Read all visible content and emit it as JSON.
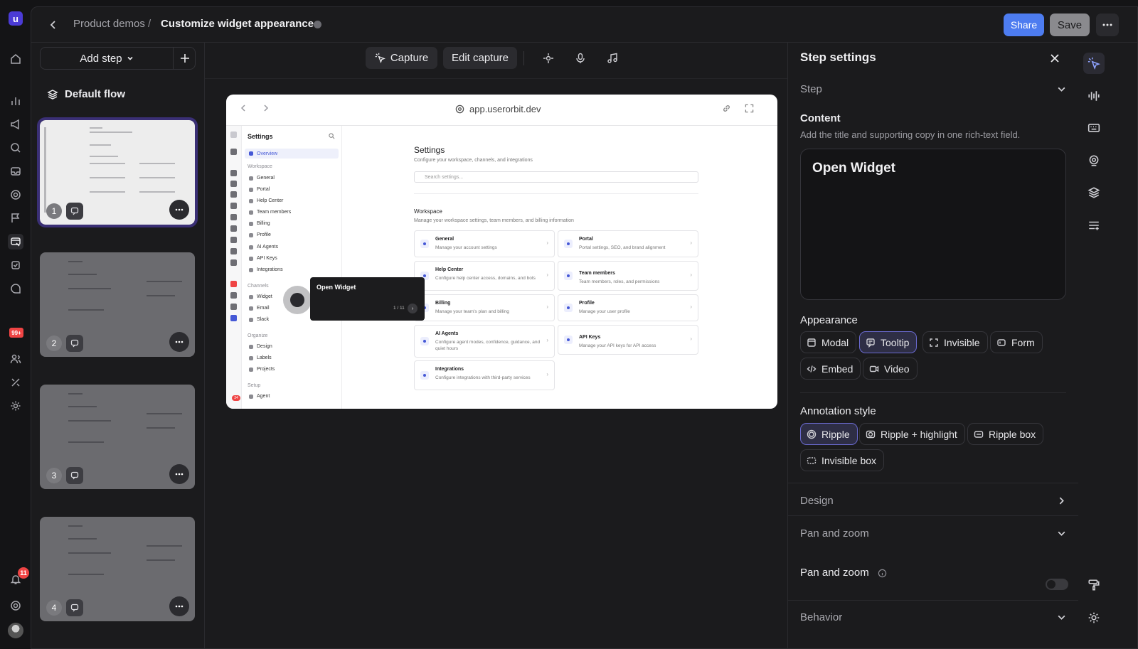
{
  "app": {
    "logo_letter": "u",
    "notification_count": "11",
    "inbox_badge": "99+"
  },
  "header": {
    "breadcrumb_parent": "Product demos",
    "breadcrumb_separator": "/",
    "breadcrumb_current": "Customize widget appearance",
    "share_label": "Share",
    "save_label": "Save"
  },
  "steps_panel": {
    "add_step_label": "Add step",
    "flow_title": "Default flow",
    "steps": [
      {
        "number": "1",
        "selected": true
      },
      {
        "number": "2",
        "selected": false
      },
      {
        "number": "3",
        "selected": false
      },
      {
        "number": "4",
        "selected": false
      }
    ]
  },
  "toolbar": {
    "capture_label": "Capture",
    "edit_capture_label": "Edit capture"
  },
  "preview": {
    "url": "app.userorbit.dev",
    "sidebar_title": "Settings",
    "sidebar_overview": "Overview",
    "sections": {
      "workspace": "Workspace",
      "channels": "Channels",
      "organize": "Organize",
      "setup": "Setup"
    },
    "workspace_items": [
      "General",
      "Portal",
      "Help Center",
      "Team members",
      "Billing",
      "Profile",
      "AI Agents",
      "API Keys",
      "Integrations"
    ],
    "channel_items": [
      "Widget",
      "Email",
      "Slack"
    ],
    "organize_items": [
      "Design",
      "Labels",
      "Projects"
    ],
    "setup_items": [
      "Agent"
    ],
    "main_title": "Settings",
    "main_subtitle": "Configure your workspace, channels, and integrations",
    "search_placeholder": "Search settings...",
    "workspace_title": "Workspace",
    "workspace_subtitle": "Manage your workspace settings, team members, and billing information",
    "cards": [
      {
        "title": "General",
        "desc": "Manage your account settings"
      },
      {
        "title": "Portal",
        "desc": "Portal settings, SEO, and brand alignment"
      },
      {
        "title": "Help Center",
        "desc": "Configure help center access, domains, and bots"
      },
      {
        "title": "Team members",
        "desc": "Team members, roles, and permissions"
      },
      {
        "title": "Billing",
        "desc": "Manage your team's plan and billing"
      },
      {
        "title": "Profile",
        "desc": "Manage your user profile"
      },
      {
        "title": "AI Agents",
        "desc": "Configure agent modes, confidence, guidance, and quiet hours"
      },
      {
        "title": "API Keys",
        "desc": "Manage your API keys for API access"
      },
      {
        "title": "Integrations",
        "desc": "Configure integrations with third-party services"
      }
    ],
    "tooltip_title": "Open Widget",
    "tooltip_counter": "1 / 11",
    "icon_rail_badge": "34"
  },
  "settings": {
    "title": "Step settings",
    "step_section": "Step",
    "content_label": "Content",
    "content_hint": "Add the title and supporting copy in one rich-text field.",
    "content_value": "Open Widget",
    "appearance_label": "Appearance",
    "appearance_options": [
      {
        "label": "Modal",
        "icon": "modal-icon",
        "selected": false
      },
      {
        "label": "Tooltip",
        "icon": "tooltip-icon",
        "selected": true
      },
      {
        "label": "Invisible",
        "icon": "invisible-icon",
        "selected": false
      },
      {
        "label": "Form",
        "icon": "form-icon",
        "selected": false
      },
      {
        "label": "Embed",
        "icon": "embed-icon",
        "selected": false
      },
      {
        "label": "Video",
        "icon": "video-icon",
        "selected": false
      }
    ],
    "annotation_label": "Annotation style",
    "annotation_options": [
      {
        "label": "Ripple",
        "selected": true
      },
      {
        "label": "Ripple + highlight",
        "selected": false
      },
      {
        "label": "Ripple box",
        "selected": false
      },
      {
        "label": "Invisible box",
        "selected": false
      }
    ],
    "design_section": "Design",
    "pan_zoom_section": "Pan and zoom",
    "pan_zoom_toggle_label": "Pan and zoom",
    "pan_zoom_enabled": false,
    "behavior_section": "Behavior"
  },
  "colors": {
    "accent": "#4d7cf0",
    "selected_chip": "#6a6ad0",
    "background": "#1b1b1d"
  }
}
